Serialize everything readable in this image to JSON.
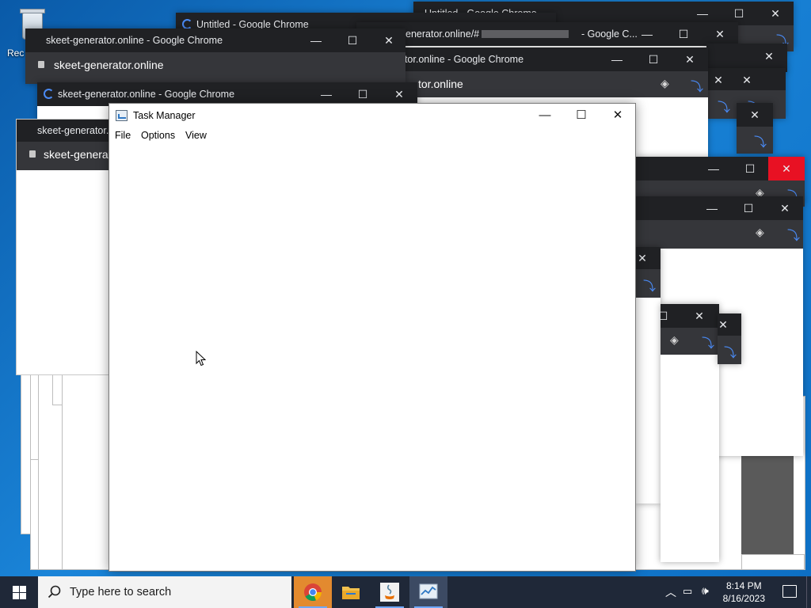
{
  "desktop": {
    "recycle_bin_label": "Rec"
  },
  "chrome_windows": [
    {
      "title": "Untitled - Google Chrome"
    },
    {
      "title": "Untitled - Google Chrome"
    },
    {
      "title": "enerator.online/#",
      "title_suffix": "- Google C..."
    },
    {
      "title": "skeet-generator.online - Google Chrome",
      "url": "skeet-generator.online"
    },
    {
      "title": "skeet-generator.online - Google Chrome",
      "url": "tor.online"
    },
    {
      "title": "skeet-generator.online - Google Chrome"
    },
    {
      "title": "skeet-generator.c",
      "url": "skeet-generat"
    }
  ],
  "task_manager": {
    "title": "Task Manager",
    "menu": [
      "File",
      "Options",
      "View"
    ],
    "minimize_glyph": "—",
    "maximize_glyph": "☐",
    "close_glyph": "✕"
  },
  "taskbar": {
    "search_placeholder": "Type here to search",
    "apps": [
      "chrome-icon",
      "file-explorer-icon",
      "java-icon",
      "task-manager-icon"
    ],
    "clock_time": "8:14 PM",
    "clock_date": "8/16/2023"
  },
  "colors": {
    "chrome_titlebar": "#202124",
    "chrome_addressbar": "#35363a",
    "close_hover": "#e81123",
    "taskbar": "#1f2838"
  }
}
